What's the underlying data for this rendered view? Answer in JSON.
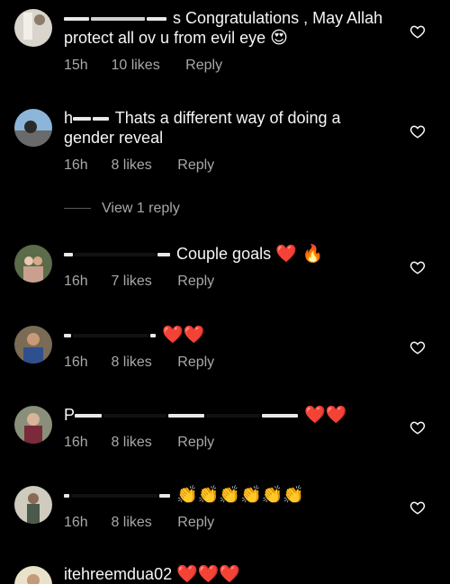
{
  "comments": [
    {
      "user": "",
      "text": "s Congratulations , May Allah protect all ov u from evil eye",
      "emoji": "😍",
      "time": "15h",
      "likes": "10 likes",
      "reply": "Reply"
    },
    {
      "user": "h",
      "text": "Thats a different way of doing a gender reveal",
      "emoji": "",
      "time": "16h",
      "likes": "8 likes",
      "reply": "Reply"
    },
    {
      "user": "",
      "text": "Couple goals",
      "emoji": "❤️ 🔥",
      "time": "16h",
      "likes": "7 likes",
      "reply": "Reply"
    },
    {
      "user": "",
      "text": "",
      "emoji": "❤️❤️",
      "time": "16h",
      "likes": "8 likes",
      "reply": "Reply"
    },
    {
      "user": "P",
      "text": "",
      "emoji": "❤️❤️",
      "time": "16h",
      "likes": "8 likes",
      "reply": "Reply"
    },
    {
      "user": "",
      "text": "",
      "emoji": "👏👏👏👏👏👏",
      "time": "16h",
      "likes": "8 likes",
      "reply": "Reply"
    },
    {
      "user": "itehreemdua02",
      "text": "",
      "emoji": "❤️❤️❤️",
      "time": "",
      "likes": "",
      "reply": ""
    }
  ],
  "view_replies": "View 1 reply",
  "colors": {
    "background": "#000000",
    "text": "#f5f5f5",
    "meta": "#a8a8a8",
    "heart": "#e11d2a"
  },
  "icons": {
    "like": "heart-outline-icon"
  }
}
